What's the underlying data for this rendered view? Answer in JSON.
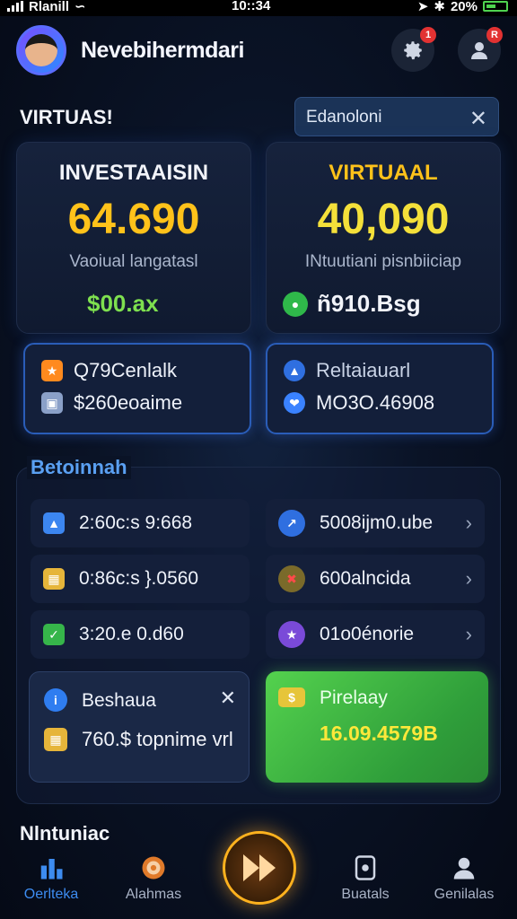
{
  "status_bar": {
    "carrier": "Rlanill",
    "time": "10::34",
    "battery": "20%"
  },
  "header": {
    "username": "Nevebihermdari",
    "settings_badge": "1",
    "profile_badge": "R"
  },
  "section": {
    "title": "VIRTUAS!",
    "search_placeholder": "Edanoloni"
  },
  "cards": [
    {
      "title": "INVESTAAISIN",
      "value": "64.690",
      "subtitle": "Vaoiual langatasl",
      "amount": "$00.ax"
    },
    {
      "title": "VIRTUAAL",
      "value": "40,090",
      "subtitle": "INtuutiani pisnbiiciap",
      "amount": "ñ910.Bsg"
    }
  ],
  "small_cards": [
    {
      "line1": "Q79Cenlalk",
      "line2": "$260eoaime"
    },
    {
      "line1": "Reltaiauarl",
      "line2": "MO3O.46908"
    }
  ],
  "panel": {
    "title": "Betoinnah",
    "left_items": [
      "2:60c:s 9:668",
      "0:86c:s }.0560",
      "3:20.e 0.d60"
    ],
    "right_items": [
      "5008ijm0.ube",
      "600alncida",
      "01o0énorie"
    ]
  },
  "wallet": {
    "label": "Beshaua",
    "value": "760.$ topnime vrl"
  },
  "promo": {
    "label": "Pirelaay",
    "value": "16.09.4579B"
  },
  "footer_label": "Nlntuniac",
  "nav": {
    "items": [
      "Oerlteka",
      "Alahmas",
      "Buatals",
      "Genilalas"
    ]
  },
  "colors": {
    "gold": "#ffc21a",
    "green": "#7ee04f",
    "accent": "#5aa0f2",
    "promo": "#54d24e"
  }
}
